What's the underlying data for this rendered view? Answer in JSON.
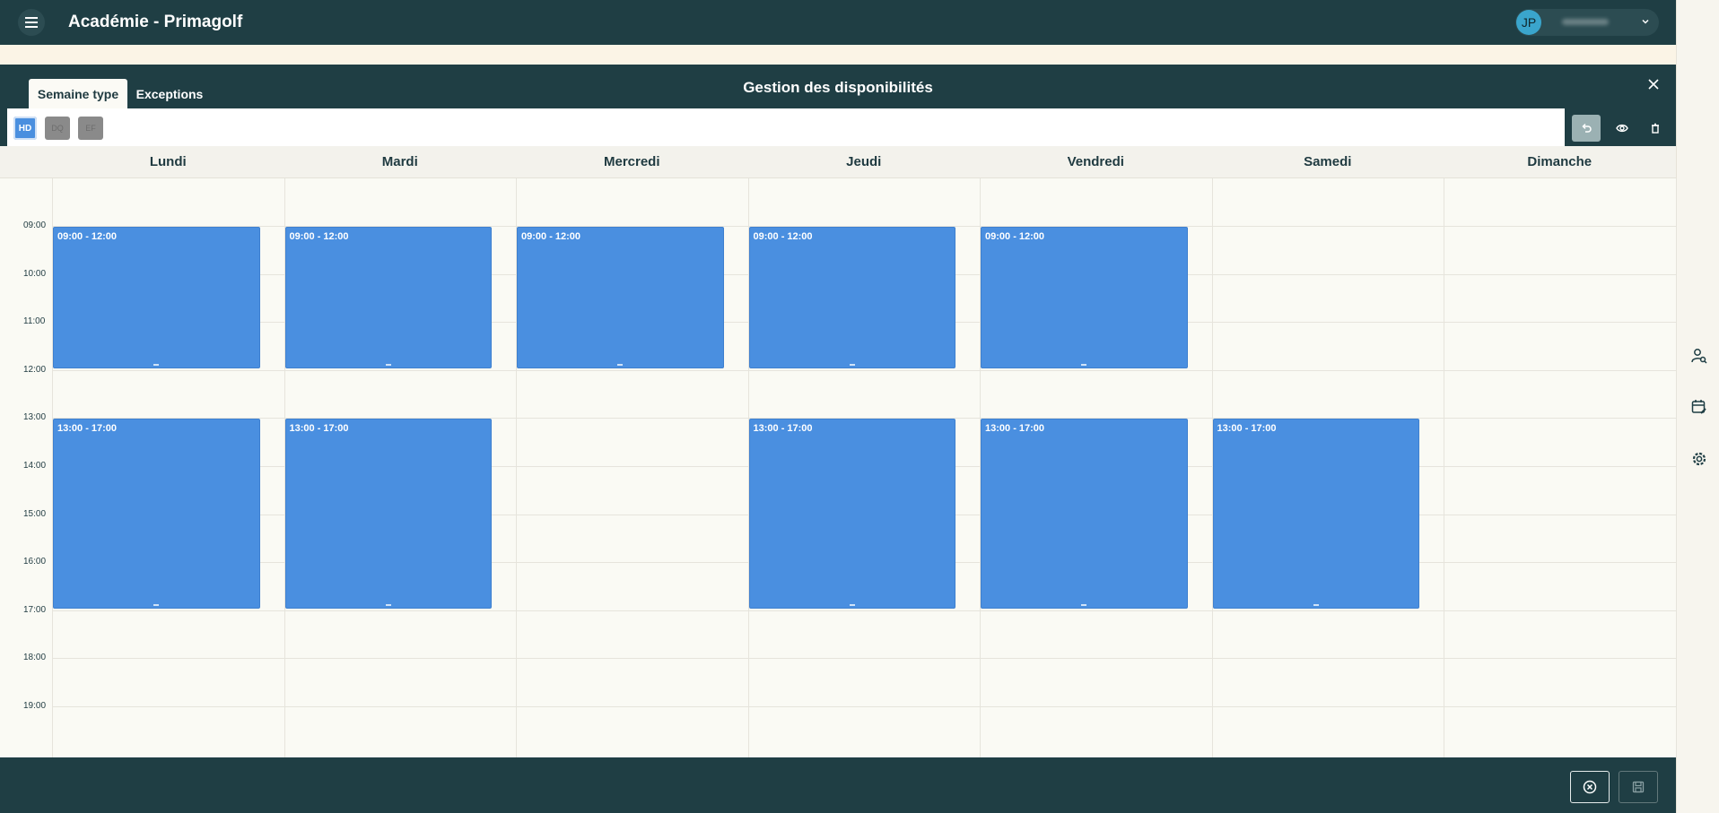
{
  "app": {
    "title": "Académie - Primagolf"
  },
  "user": {
    "initials": "JP"
  },
  "modal": {
    "title": "Gestion des disponibilités",
    "tabs": [
      {
        "label": "Semaine type",
        "active": true
      },
      {
        "label": "Exceptions",
        "active": false
      }
    ]
  },
  "toolbar": {
    "view_buttons": [
      {
        "label": "HD",
        "selected": true
      },
      {
        "label": "DQ",
        "selected": false
      },
      {
        "label": "EF",
        "selected": false
      }
    ],
    "actions": [
      {
        "icon": "undo-icon"
      },
      {
        "icon": "eye-icon"
      },
      {
        "icon": "trash-icon"
      }
    ]
  },
  "calendar": {
    "days": [
      "Lundi",
      "Mardi",
      "Mercredi",
      "Jeudi",
      "Vendredi",
      "Samedi",
      "Dimanche"
    ],
    "hours": [
      "09:00",
      "10:00",
      "11:00",
      "12:00",
      "13:00",
      "14:00",
      "15:00",
      "16:00",
      "17:00",
      "18:00",
      "19:00"
    ],
    "slots": [
      {
        "day": 0,
        "start": "09:00",
        "end": "12:00",
        "label": "09:00 - 12:00"
      },
      {
        "day": 1,
        "start": "09:00",
        "end": "12:00",
        "label": "09:00 - 12:00"
      },
      {
        "day": 2,
        "start": "09:00",
        "end": "12:00",
        "label": "09:00 - 12:00"
      },
      {
        "day": 3,
        "start": "09:00",
        "end": "12:00",
        "label": "09:00 - 12:00"
      },
      {
        "day": 4,
        "start": "09:00",
        "end": "12:00",
        "label": "09:00 - 12:00"
      },
      {
        "day": 0,
        "start": "13:00",
        "end": "17:00",
        "label": "13:00 - 17:00"
      },
      {
        "day": 1,
        "start": "13:00",
        "end": "17:00",
        "label": "13:00 - 17:00"
      },
      {
        "day": 3,
        "start": "13:00",
        "end": "17:00",
        "label": "13:00 - 17:00"
      },
      {
        "day": 4,
        "start": "13:00",
        "end": "17:00",
        "label": "13:00 - 17:00"
      },
      {
        "day": 5,
        "start": "13:00",
        "end": "17:00",
        "label": "13:00 - 17:00"
      }
    ]
  },
  "sidebar_icons": [
    "user-search-icon",
    "calendar-edit-icon",
    "gear-icon"
  ],
  "footer": {
    "buttons": [
      {
        "icon": "cancel-circle-icon"
      },
      {
        "icon": "save-icon"
      }
    ]
  },
  "colors": {
    "header": "#1f3e44",
    "slot": "#4a8fe0",
    "accent": "#3aa5cc"
  }
}
